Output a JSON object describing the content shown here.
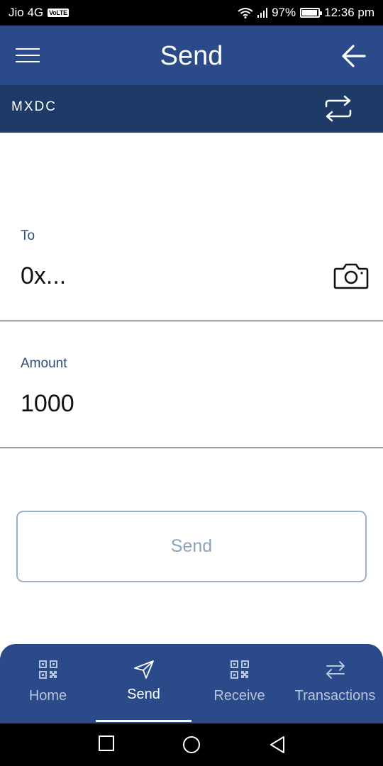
{
  "status_bar": {
    "carrier": "Jio 4G",
    "volte": "VoLTE",
    "battery": "97%",
    "battery_level": 0.97,
    "time": "12:36 pm"
  },
  "header": {
    "title": "Send"
  },
  "token_bar": {
    "token": "MXDC"
  },
  "form": {
    "to_label": "To",
    "to_value": "0x...",
    "amount_label": "Amount",
    "amount_value": "1000",
    "send_label": "Send"
  },
  "bottom_nav": {
    "items": [
      {
        "label": "Home",
        "icon": "qr-code-icon",
        "active": false
      },
      {
        "label": "Send",
        "icon": "paper-plane-icon",
        "active": true
      },
      {
        "label": "Receive",
        "icon": "qr-code-icon",
        "active": false
      },
      {
        "label": "Transactions",
        "icon": "arrows-swap-icon",
        "active": false
      }
    ]
  },
  "colors": {
    "app_bar": "#2a4a8a",
    "token_bar": "#1e3a66",
    "label_text": "#2a4a7a",
    "button_border": "#9eb0c8"
  }
}
